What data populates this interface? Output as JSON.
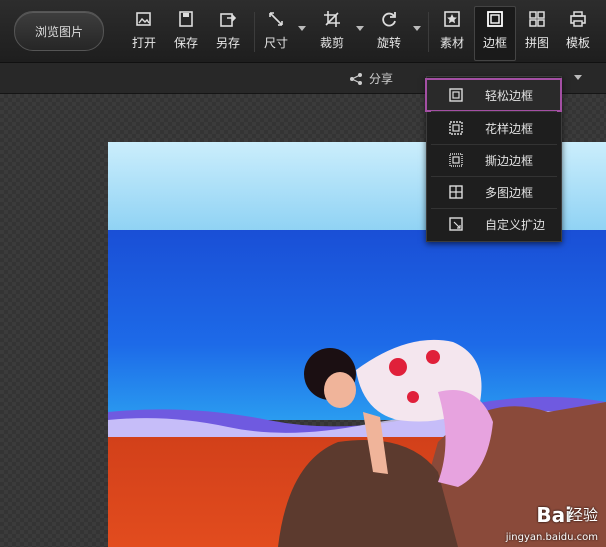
{
  "toolbar": {
    "browse_label": "浏览图片",
    "tools": [
      {
        "label": "打开",
        "icon": "open-image-icon"
      },
      {
        "label": "保存",
        "icon": "save-icon"
      },
      {
        "label": "另存",
        "icon": "save-as-icon"
      },
      {
        "label": "尺寸",
        "icon": "resize-icon"
      },
      {
        "label": "裁剪",
        "icon": "crop-icon"
      },
      {
        "label": "旋转",
        "icon": "rotate-icon"
      },
      {
        "label": "素材",
        "icon": "material-star-icon"
      },
      {
        "label": "边框",
        "icon": "border-icon"
      },
      {
        "label": "拼图",
        "icon": "collage-grid-icon"
      },
      {
        "label": "模板",
        "icon": "template-printer-icon"
      }
    ]
  },
  "subbar": {
    "share_label": "分享"
  },
  "border_menu": {
    "items": [
      {
        "label": "轻松边框",
        "icon": "easy-border-icon"
      },
      {
        "label": "花样边框",
        "icon": "pattern-border-icon"
      },
      {
        "label": "撕边边框",
        "icon": "torn-border-icon"
      },
      {
        "label": "多图边框",
        "icon": "multi-image-border-icon"
      },
      {
        "label": "自定义扩边",
        "icon": "custom-extend-icon"
      }
    ]
  },
  "watermark": {
    "brand": "Bai",
    "sub": "经验",
    "url": "jingyan.baidu.com"
  },
  "colors": {
    "highlight": "#a44fa4",
    "toolbar": "#252525"
  }
}
